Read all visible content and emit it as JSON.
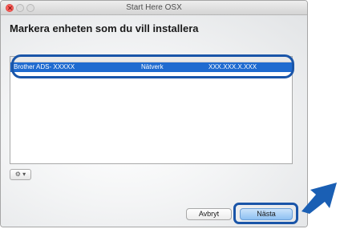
{
  "window": {
    "title": "Start Here OSX"
  },
  "page": {
    "heading": "Markera enheten som du vill installera"
  },
  "device_list": {
    "selected_row": {
      "name": "Brother ADS- XXXXX",
      "connection": "Nätverk",
      "address": "XXX.XXX.X.XXX"
    }
  },
  "buttons": {
    "cancel": "Avbryt",
    "next": "Nästa",
    "gear_icon": "⚙ ▾"
  },
  "colors": {
    "highlight": "#1a55a8",
    "selection": "#1f6bd0",
    "default_button": "#8ec0f2"
  },
  "icons": [
    "close-icon",
    "minimize-icon",
    "zoom-icon",
    "gear-icon",
    "pointer-arrow-icon"
  ]
}
